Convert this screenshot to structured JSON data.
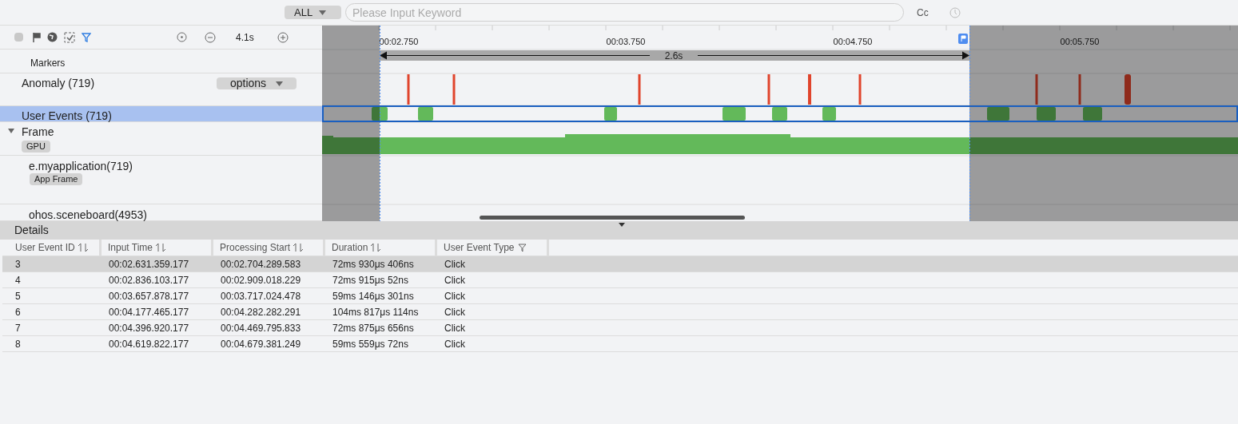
{
  "search_bar": {
    "scope": "ALL",
    "placeholder": "Please Input Keyword",
    "case_toggle": "Cc"
  },
  "toolbar": {
    "zoom_value": "4.1s"
  },
  "timeline": {
    "ticks": [
      "00:02.750",
      "00:03.750",
      "00:04.750",
      "00:05.750"
    ],
    "range": "2.6s"
  },
  "tracks": [
    {
      "kind": "markers",
      "label": "Markers",
      "selected": false
    },
    {
      "kind": "anomaly",
      "label": "Anomaly (719)",
      "button": "options",
      "selected": false
    },
    {
      "kind": "events",
      "label": "User Events (719)",
      "selected": true
    },
    {
      "kind": "group",
      "label": "Frame",
      "tag": "GPU",
      "expanded": true,
      "selected": false
    },
    {
      "kind": "process",
      "label": "e.myapplication(719)",
      "tag": "App Frame",
      "selected": false
    },
    {
      "kind": "process",
      "label": "ohos.sceneboard(4953)",
      "selected": false
    }
  ],
  "details": {
    "title": "Details",
    "columns": [
      {
        "label": "User Event ID",
        "kind": "sort"
      },
      {
        "label": "Input Time",
        "kind": "sort"
      },
      {
        "label": "Processing Start",
        "kind": "sort"
      },
      {
        "label": "Duration",
        "kind": "sort"
      },
      {
        "label": "User Event Type",
        "kind": "filter"
      }
    ],
    "rows": [
      {
        "cells": [
          "3",
          "00:02.631.359.177",
          "00:02.704.289.583",
          "72ms 930μs 406ns",
          "Click"
        ],
        "selected": true
      },
      {
        "cells": [
          "4",
          "00:02.836.103.177",
          "00:02.909.018.229",
          "72ms 915μs 52ns",
          "Click"
        ],
        "selected": false
      },
      {
        "cells": [
          "5",
          "00:03.657.878.177",
          "00:03.717.024.478",
          "59ms 146μs 301ns",
          "Click"
        ],
        "selected": false
      },
      {
        "cells": [
          "6",
          "00:04.177.465.177",
          "00:04.282.282.291",
          "104ms 817μs 114ns",
          "Click"
        ],
        "selected": false
      },
      {
        "cells": [
          "7",
          "00:04.396.920.177",
          "00:04.469.795.833",
          "72ms 875μs 656ns",
          "Click"
        ],
        "selected": false
      },
      {
        "cells": [
          "8",
          "00:04.619.822.177",
          "00:04.679.381.249",
          "59ms 559μs 72ns",
          "Click"
        ],
        "selected": false
      }
    ]
  }
}
